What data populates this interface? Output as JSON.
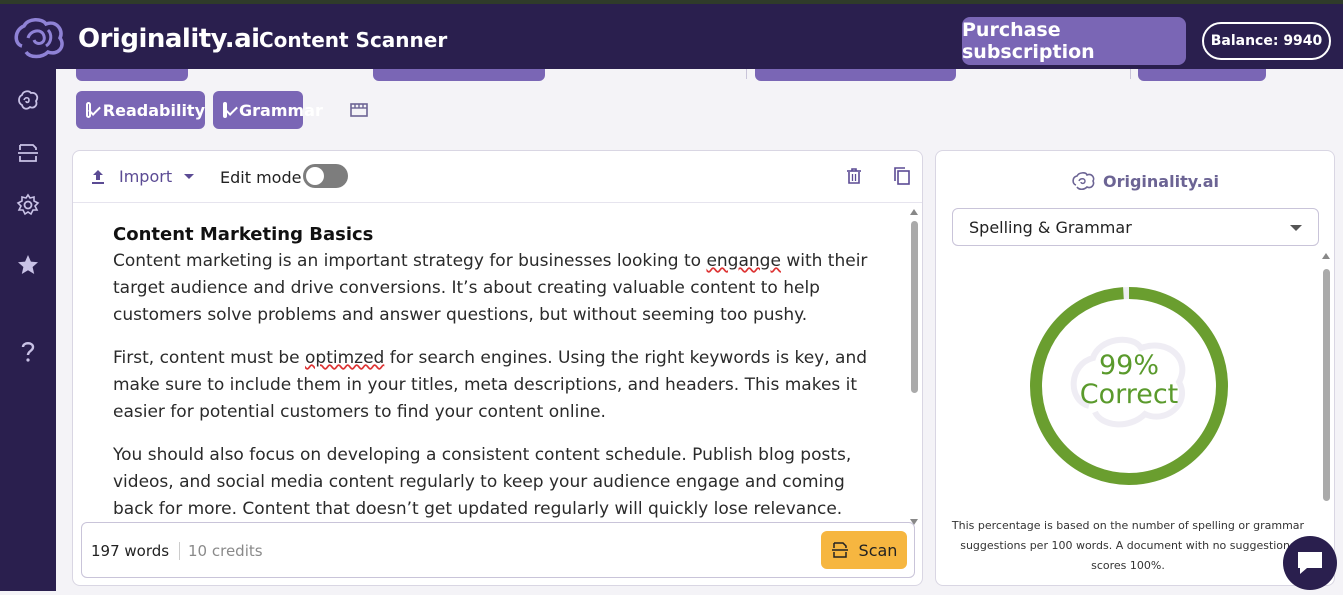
{
  "header": {
    "brand": "Originality.ai",
    "app_title": "Content Scanner",
    "purchase_label": "Purchase subscription",
    "balance_label": "Balance: 9940"
  },
  "sidebar": {
    "items": [
      {
        "icon": "brain-icon"
      },
      {
        "icon": "scan-doc-icon"
      },
      {
        "icon": "gear-icon"
      },
      {
        "icon": "star-icon"
      },
      {
        "icon": "help-icon"
      }
    ]
  },
  "options": {
    "chips": [
      {
        "label": "Readability",
        "checked": true
      },
      {
        "label": "Grammar",
        "checked": true
      }
    ],
    "film_icon": "film-icon"
  },
  "editor": {
    "import_label": "Import",
    "edit_mode_label": "Edit mode",
    "edit_mode_on": false,
    "doc_title": "Content Marketing Basics",
    "p1_a": "Content marketing is an important strategy for businesses looking to ",
    "p1_err": "engange",
    "p1_b": " with their target audience and drive conversions. It’s about creating valuable content to help customers solve problems and answer questions, but without seeming too pushy.",
    "p2_a": "First, content must be ",
    "p2_err": "optimzed",
    "p2_b": " for search engines. Using the right keywords is key, and make sure to include them in your titles, meta descriptions, and headers. This makes it easier for potential customers to find your content online.",
    "p3": "You should also focus on developing a consistent content schedule. Publish blog posts, videos, and social media content regularly to keep your audience engage and coming back for more. Content that doesn’t get updated regularly will quickly lose relevance.",
    "words_label": "197 words",
    "credits_label": "10 credits",
    "scan_label": "Scan"
  },
  "panel": {
    "brand": "Originality.ai",
    "select_value": "Spelling & Grammar",
    "score_value": "99%",
    "score_label": "Correct",
    "score_fraction": 0.99,
    "note": "This percentage is based on the number of spelling or grammar suggestions per 100 words. A document with no suggestions scores 100%.",
    "accent": "#6a9e2f"
  },
  "colors": {
    "nav_bg": "#2a1f4e",
    "chip_bg": "#7a66b5",
    "scan_bg": "#f6b640"
  }
}
